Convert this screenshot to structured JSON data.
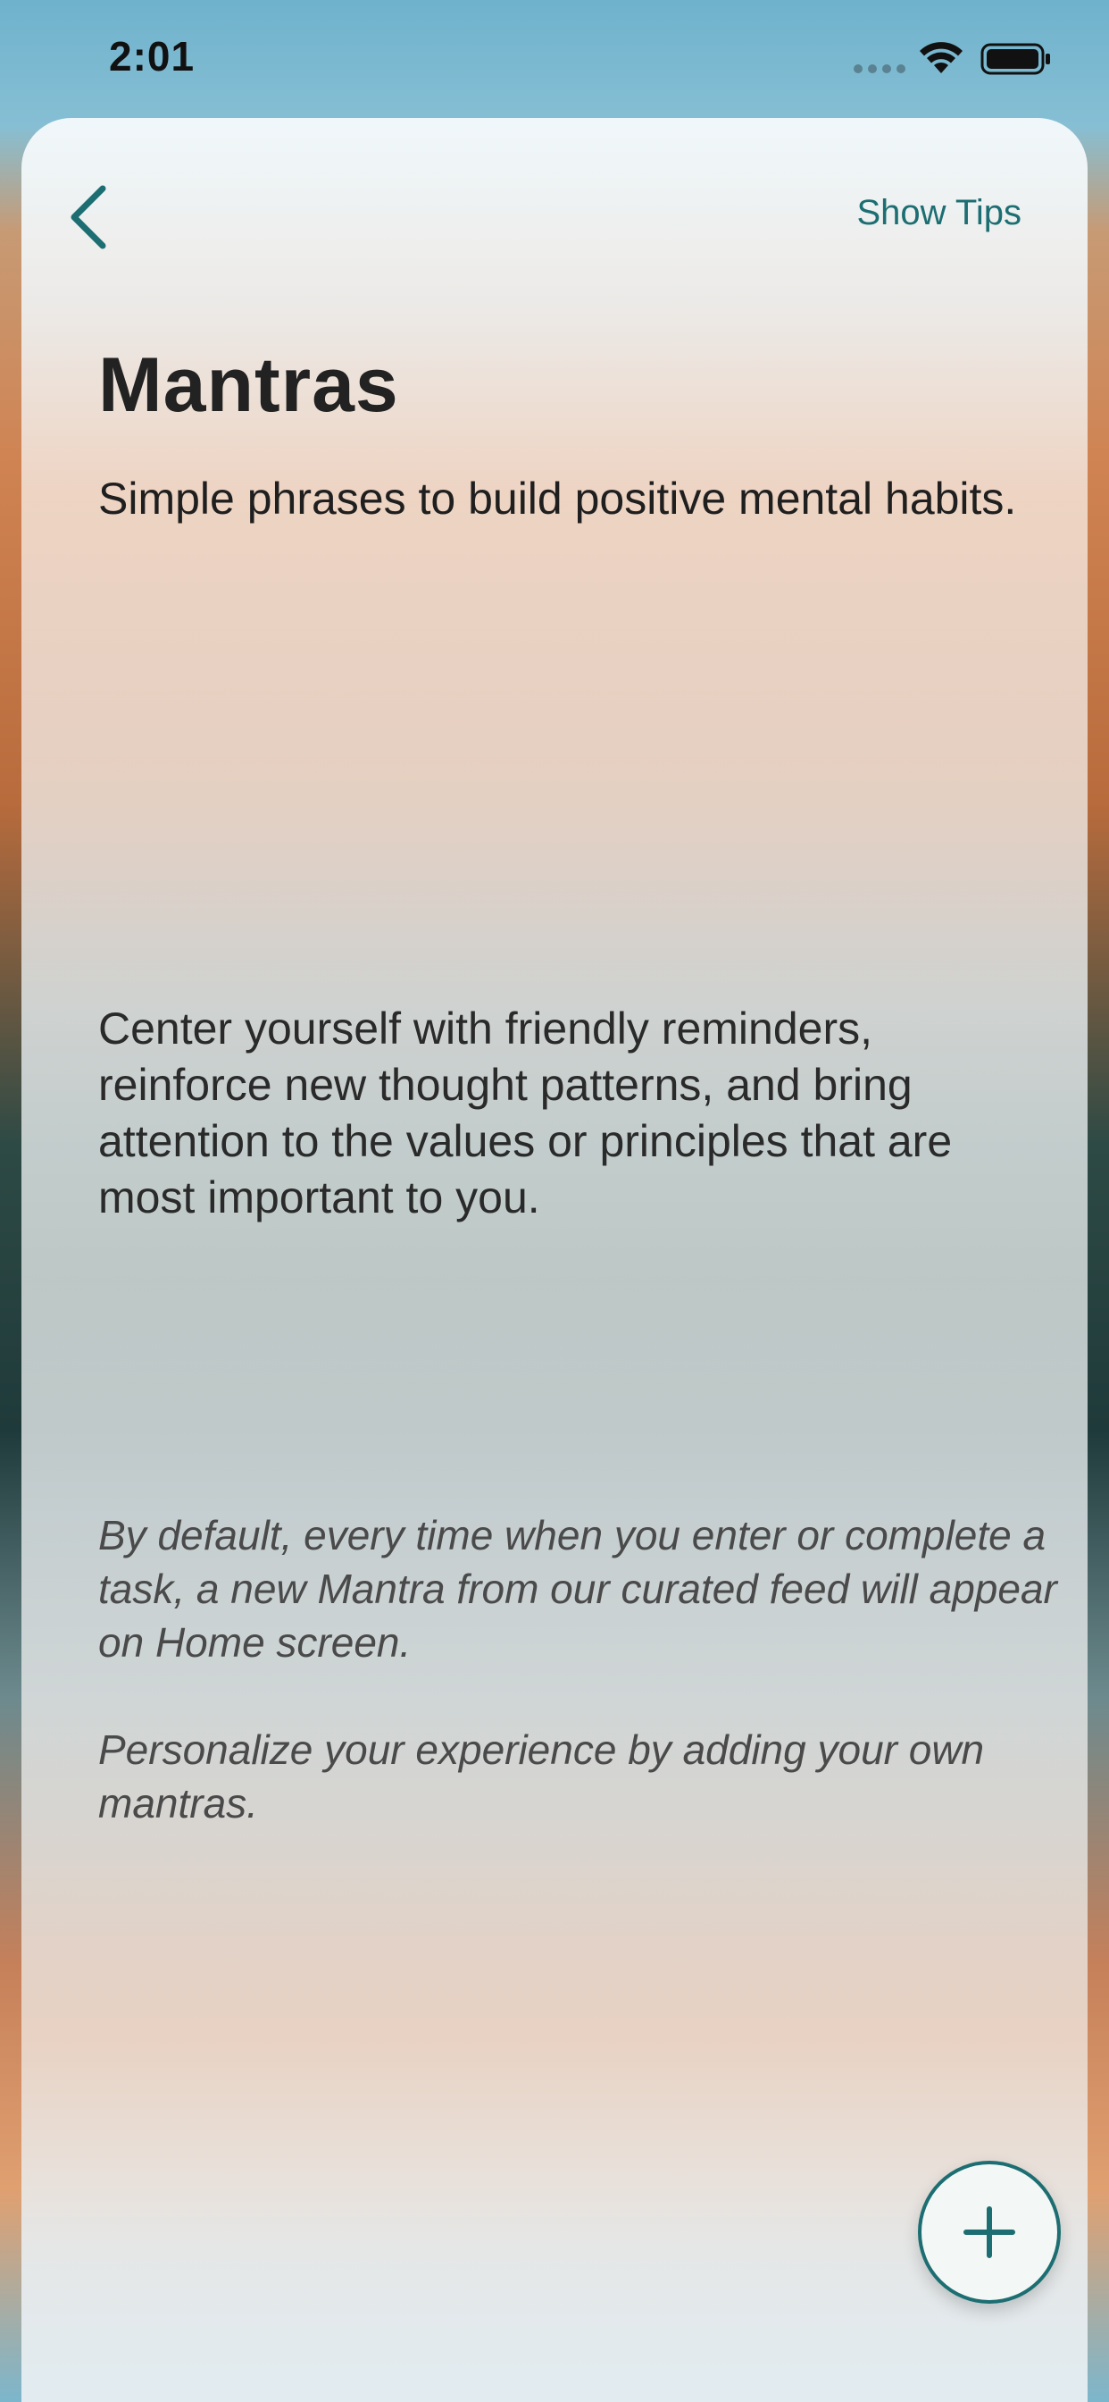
{
  "status_bar": {
    "time": "2:01",
    "icons": [
      "signal-icon",
      "wifi-icon",
      "battery-icon"
    ]
  },
  "header": {
    "back_icon": "chevron-left-icon",
    "show_tips_label": "Show Tips"
  },
  "main": {
    "title": "Mantras",
    "subtitle": "Simple phrases to build positive mental habits.",
    "description": "Center yourself with friendly reminders, reinforce new thought patterns, and bring attention to the values or principles that are most important to you.",
    "note_default": "By default, every time when you enter or complete a task, a new Mantra from our curated feed will appear on Home screen.",
    "note_personalize": "Personalize your experience by adding your own mantras."
  },
  "fab": {
    "icon": "plus-icon"
  },
  "colors": {
    "accent": "#1c6e72",
    "title_text": "#222222",
    "note_text": "#4a4a4a"
  }
}
